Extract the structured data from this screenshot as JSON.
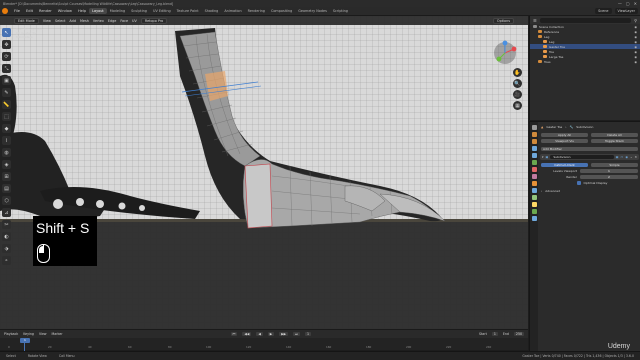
{
  "window": {
    "title": "Blender* [D:\\Documents\\Bennetts\\Sculpt Courses\\Modelling Wildlife\\Cassowary\\Leg\\Cassowary_Leg.blend]",
    "controls": [
      "—",
      "▢",
      "✕"
    ]
  },
  "menubar": {
    "items": [
      "File",
      "Edit",
      "Render",
      "Window",
      "Help"
    ],
    "workspaces": [
      "Layout",
      "Modeling",
      "Sculpting",
      "UV Editing",
      "Texture Paint",
      "Shading",
      "Animation",
      "Rendering",
      "Compositing",
      "Geometry Nodes",
      "Scripting"
    ],
    "active_workspace": "Layout",
    "scene": "Scene",
    "view_layer": "ViewLayer"
  },
  "viewport_header": {
    "mode": "Edit Mode",
    "items": [
      "View",
      "Select",
      "Add",
      "Mesh",
      "Vertex",
      "Edge",
      "Face",
      "UV"
    ],
    "pivot": "Retopo Pro",
    "options": "Options"
  },
  "viewport_info": {
    "line1": "User Orthographic",
    "line2": "(1) Gaster Toe",
    "line3": "Millimeters"
  },
  "tools": [
    "↖",
    "✥",
    "⟳",
    "⤡",
    "▣",
    "✎",
    "📏",
    "⬚",
    "◆",
    "⌇",
    "◍",
    "◈",
    "⊞",
    "▤",
    "⬡",
    "⊿",
    "✂",
    "◐",
    "⬗",
    "⚬"
  ],
  "nav_buttons": [
    "✋",
    "🔍",
    "🎥",
    "▦"
  ],
  "key_overlay": {
    "text": "Shift + S"
  },
  "timeline": {
    "items": [
      "Playback",
      "Keying",
      "View",
      "Marker"
    ],
    "current_frame": "1",
    "start_label": "Start",
    "start": "1",
    "end_label": "End",
    "end": "250",
    "ticks": [
      "0",
      "20",
      "40",
      "60",
      "80",
      "100",
      "120",
      "140",
      "160",
      "180",
      "200",
      "220",
      "240"
    ],
    "transport": [
      "⏮",
      "◀◀",
      "◀",
      "▶",
      "▶▶",
      "⏭"
    ]
  },
  "statusbar": {
    "select": "Select",
    "box": "Rotate View",
    "menu": "Call Menu",
    "stats": "Gaster Toe | Verts 0/740 | Faces 0/722 | Tris 1,436 | Objects 1/3 | 3.6.0"
  },
  "watermark": "Udemy",
  "outliner": {
    "search_placeholder": "",
    "rows": [
      {
        "label": "Scene Collection",
        "indent": 0,
        "color": "#8c8c8c",
        "selected": false
      },
      {
        "label": "Reference",
        "indent": 1,
        "color": "#d48b3b",
        "selected": false
      },
      {
        "label": "Leg",
        "indent": 1,
        "color": "#d48b3b",
        "selected": false
      },
      {
        "label": "Leg",
        "indent": 2,
        "color": "#e89a4a",
        "selected": false
      },
      {
        "label": "Gaster Toe",
        "indent": 2,
        "color": "#e89a4a",
        "selected": true
      },
      {
        "label": "Toe",
        "indent": 2,
        "color": "#e89a4a",
        "selected": false
      },
      {
        "label": "Large Toe",
        "indent": 2,
        "color": "#e89a4a",
        "selected": false
      },
      {
        "label": "Toes",
        "indent": 1,
        "color": "#d48b3b",
        "selected": false
      }
    ]
  },
  "properties": {
    "object_name": "Gaster Toe",
    "modifier_tab": "Subdivision",
    "apply_all": "Apply All",
    "delete_all": "Delete All",
    "viewport_vis": "Viewport Vis",
    "toggle_stack": "Toggle Stack",
    "add_modifier": "Add Modifier",
    "modifier_name": "Subdivision",
    "catmull": "Catmull-Clark",
    "simple": "Simple",
    "levels_viewport_label": "Levels Viewport",
    "levels_viewport": "1",
    "render_label": "Render",
    "render": "2",
    "optimal_display": "Optimal Display",
    "advanced": "Advanced",
    "tab_colors": [
      "#9a9a9a",
      "#d08a3c",
      "#d08a3c",
      "#6fa8dc",
      "#6fa8dc",
      "#6aa84f",
      "#e06666",
      "#c27ba0",
      "#e69138",
      "#6fa8dc",
      "#93c47d",
      "#ffd966",
      "#6aa84f",
      "#6fa8dc"
    ]
  },
  "colors": {
    "accent": "#4772b3",
    "selection": "#334d80",
    "blender_orange": "#e87d0d"
  }
}
